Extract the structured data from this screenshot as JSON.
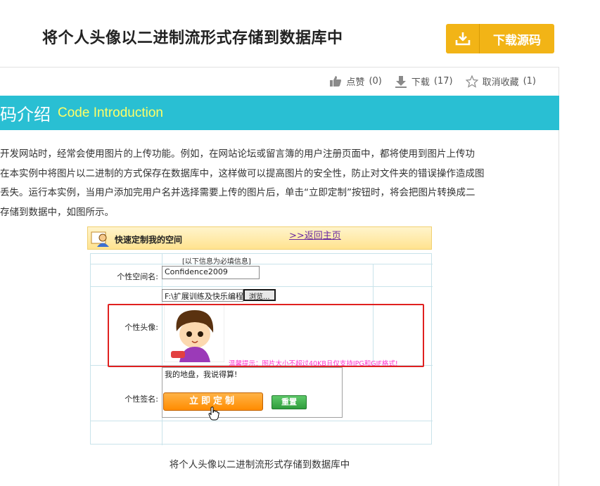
{
  "header": {
    "title": "将个人头像以二进制流形式存储到数据库中",
    "download_label": "下载源码"
  },
  "actions": {
    "like_label": "点赞",
    "like_count": "(0)",
    "download_label": "下载",
    "download_count": "(17)",
    "fav_label": "取消收藏",
    "fav_count": "(1)"
  },
  "section": {
    "title_cn": "码介绍",
    "title_en": "Code Introduction"
  },
  "description": [
    "开发网站时，经常会使用图片的上传功能。例如，在网站论坛或留言簿的用户注册页面中，都将使用到图片上传功",
    "在本实例中将图片以二进制的方式保存在数据库中，这样做可以提高图片的安全性，防止对文件夹的错误操作造成图",
    "丢失。运行本实例，当用户添加完用户名并选择需要上传的图片后，单击“立即定制”按钮时，将会把图片转换成二",
    "存储到数据中，如图所示。"
  ],
  "screenshot": {
    "heading": "快速定制我的空间",
    "back_link": ">>返回主页",
    "required_note": "[以下信息为必填信息]",
    "space_name_label": "个性空间名:",
    "space_name_value": "Confidence2009",
    "file_path_value": "F:\\扩展训练及快乐编程",
    "browse_label": "浏览...",
    "avatar_label": "个性头像:",
    "hint": "温馨提示：图片大小不超过40KB且仅支持JPG和GIF格式!",
    "signature_label": "个性签名:",
    "signature_value": "我的地盘，我说得算!",
    "submit_label": "立即定制",
    "reset_label": "重置"
  },
  "caption": "将个人头像以二进制流形式存储到数据库中",
  "colors": {
    "accent": "#29bfd3",
    "download_button": "#f2b416",
    "highlight_box": "#e0201f"
  }
}
